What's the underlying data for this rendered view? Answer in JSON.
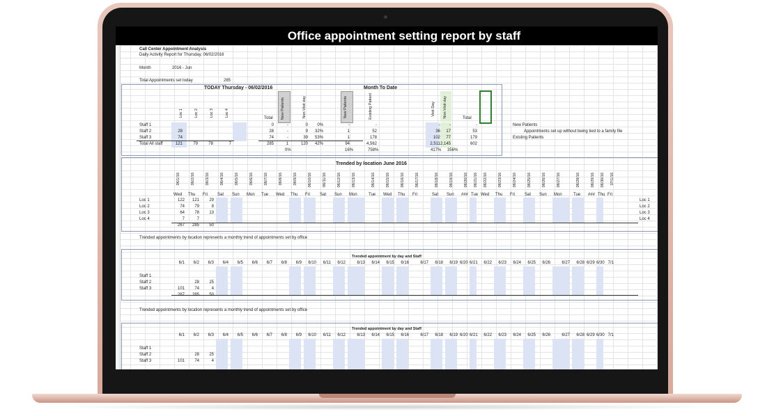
{
  "report": {
    "title": "Office appointment setting  report by staff",
    "org": "Call Center Appointment Analysis",
    "subtitle": "Daily Activity Report for Thursday, 06/02/2016",
    "month_label": "Month",
    "month_value": "2016 - Jun",
    "total_label": "Total Appointments set today",
    "total_value": "285"
  },
  "today": {
    "heading": "TODAY Thursday - 06/02/2016",
    "month_to_date": "Month To Date",
    "loc_headers": [
      "Loc 1",
      "Loc 2",
      "Loc 3",
      "Loc 4"
    ],
    "total_header": "Total",
    "new_patients_header": "New Patients",
    "non_visit_header": "Non-Visit day",
    "mtd_new_header": "New Patients",
    "mtd_existing_header": "Existing Patient",
    "visit_day_header": "Visit Day",
    "mtd_non_visit_header": "Non-Visit day",
    "grand_total_header": "Total",
    "rows": [
      {
        "label": "Staff 1",
        "loc1": "",
        "loc2": "",
        "loc3": "",
        "loc4": "",
        "total": "0",
        "np": "-",
        "nv": "0",
        "pct": "0%",
        "mnp": "-",
        "mex": "-",
        "vd": "-",
        "mnv": "-",
        "gt": "-"
      },
      {
        "label": "Staff 2",
        "loc1": "28",
        "loc2": "",
        "loc3": "",
        "loc4": "",
        "total": "28",
        "np": "-",
        "nv": "9",
        "pct": "32%",
        "mnp": "1",
        "mex": "52",
        "vd": "36",
        "mnv": "17",
        "gt": "53"
      },
      {
        "label": "Staff 3",
        "loc1": "74",
        "loc2": "",
        "loc3": "",
        "loc4": "",
        "total": "74",
        "np": "-",
        "nv": "39",
        "pct": "53%",
        "mnp": "1",
        "mex": "178",
        "vd": "102",
        "mnv": "77",
        "gt": "179"
      },
      {
        "label": "Total All staff",
        "loc1": "121",
        "loc2": "79",
        "loc3": "78",
        "loc4": "7",
        "total": "285",
        "np": "1",
        "nv": "120",
        "pct": "42%",
        "mnp": "94",
        "mex": "4,562",
        "vd": "2,511",
        "mnv": "2,145",
        "gt": "602"
      }
    ],
    "footer_pct": "0%",
    "footer_mtd_pct1": "16%",
    "footer_mtd_pct2": "758%",
    "footer_vd_pct1": "417%",
    "footer_vd_pct2": "356%",
    "notes": [
      "New Patients",
      "Appointments set up without being tied to a family file",
      "Existing Patients"
    ]
  },
  "trend": {
    "heading": "Trended by location June 2016",
    "dates": [
      "06/1/16",
      "06/2/16",
      "06/3/16",
      "06/4/16",
      "06/5/16",
      "06/6/16",
      "06/7/16",
      "06/8/16",
      "06/9/16",
      "06/10/16",
      "06/11/16",
      "06/12/16",
      "06/13/16",
      "06/14/16",
      "06/15/16",
      "06/16/16",
      "06/17/16",
      "06/18/16",
      "06/19/16",
      "06/20/16",
      "06/21/16",
      "06/22/16",
      "06/23/16",
      "06/24/16",
      "06/25/16",
      "06/26/16",
      "06/27/16",
      "06/28/16",
      "06/29/16",
      "06/30/16",
      "07/1/16"
    ],
    "days": [
      "Wed",
      "Thu",
      "Fri",
      "Sat",
      "Sun",
      "Mon",
      "Tue",
      "Wed",
      "Thu",
      "Fri",
      "Sat",
      "Sun",
      "Mon",
      "Tue",
      "Wed",
      "Thu",
      "Fri",
      "Sat",
      "Sun",
      "###",
      "Tue",
      "Wed",
      "Thu",
      "Fri",
      "Sat",
      "Sun",
      "Mon",
      "Tue",
      "###",
      "Thu",
      "Fri"
    ],
    "rows": [
      {
        "label": "Loc 1",
        "v": [
          "122",
          "121",
          "29"
        ]
      },
      {
        "label": "Loc 2",
        "v": [
          "74",
          "79",
          "8"
        ]
      },
      {
        "label": "Loc 3",
        "v": [
          "64",
          "78",
          "13"
        ]
      },
      {
        "label": "Loc 4",
        "v": [
          "7",
          "7",
          ""
        ]
      }
    ],
    "totals": [
      "267",
      "285",
      "50"
    ],
    "note": "Trended appointments by location represents a monthly trend of appointments set by office"
  },
  "staff_trend": {
    "heading": "Trended appointment by day and Staff",
    "dates": [
      "6/1",
      "6/2",
      "6/3",
      "6/4",
      "6/5",
      "6/6",
      "6/7",
      "6/8",
      "6/9",
      "6/10",
      "6/11",
      "6/12",
      "6/13",
      "6/14",
      "6/15",
      "6/16",
      "6/17",
      "6/18",
      "6/19",
      "6/20",
      "6/21",
      "6/22",
      "6/23",
      "6/24",
      "6/25",
      "6/26",
      "6/27",
      "6/28",
      "6/29",
      "6/30",
      "7/1"
    ],
    "rows": [
      {
        "label": "Staff 1",
        "v": [
          "",
          "",
          ""
        ]
      },
      {
        "label": "Staff 2",
        "v": [
          "",
          "28",
          "25"
        ]
      },
      {
        "label": "Staff 3",
        "v": [
          "101",
          "74",
          "4"
        ]
      }
    ],
    "totals": [
      "267",
      "285",
      "50"
    ],
    "note": "Trended appointments by location represents a monthly trend of appointments set by office"
  },
  "staff_trend2": {
    "heading": "Trended appointment by day and Staff",
    "rows": [
      {
        "label": "Staff 1",
        "v": [
          "",
          "",
          ""
        ]
      },
      {
        "label": "Staff 2",
        "v": [
          "",
          "28",
          "25"
        ]
      },
      {
        "label": "Staff 3",
        "v": [
          "101",
          "74",
          "4"
        ]
      }
    ]
  }
}
